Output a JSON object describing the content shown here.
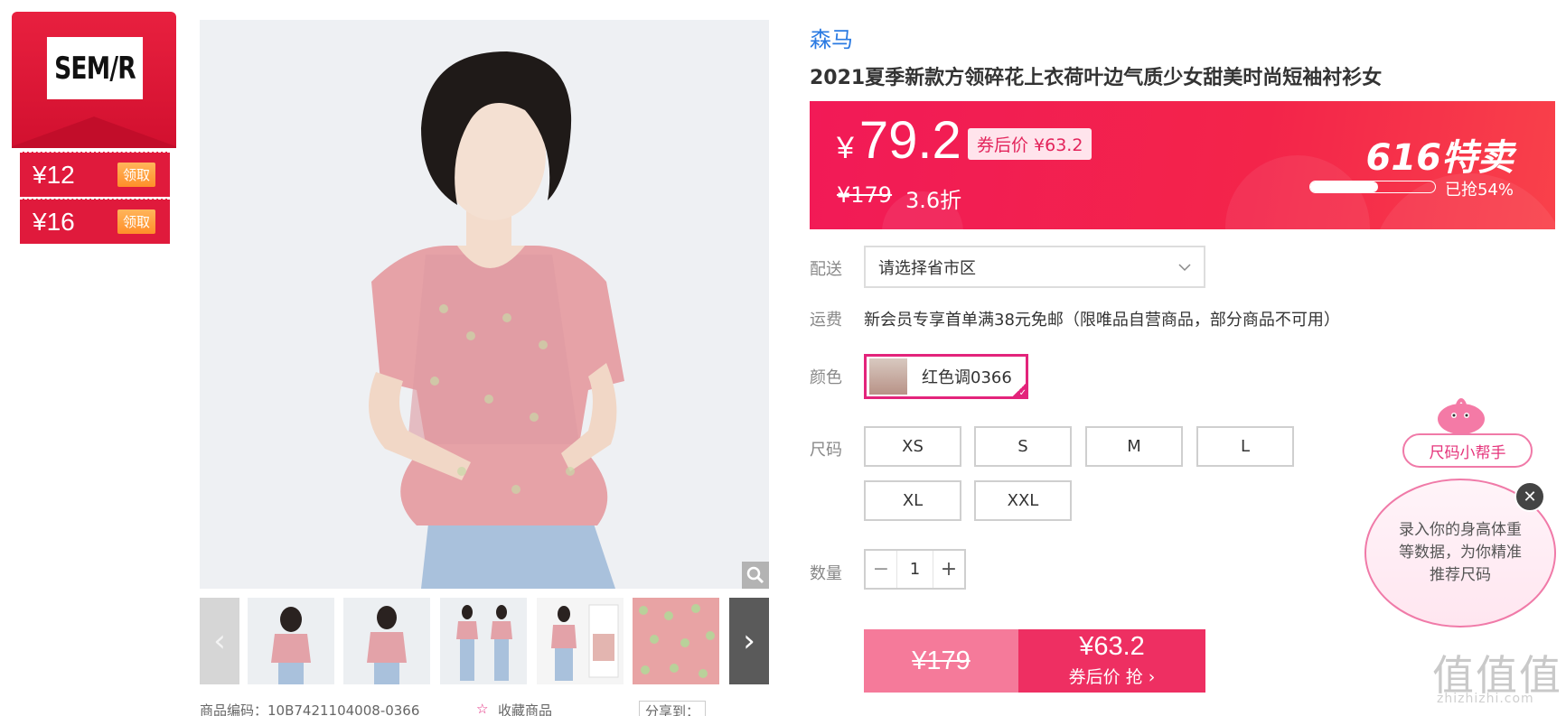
{
  "brand_badge": {
    "logo_text": "SEM/R",
    "coupons": [
      {
        "amount": "¥12",
        "action": "领取"
      },
      {
        "amount": "¥16",
        "action": "领取"
      }
    ]
  },
  "gallery": {
    "main_image": "floral-blouse-model-photo",
    "zoom_icon": "magnifier-icon",
    "thumbnail_count": 6,
    "prev_arrow": "‹",
    "next_arrow": "›",
    "bottom": {
      "product_code_label": "商品编码：10B7421104008-0366",
      "favorite_label": "收藏商品",
      "share_label": "分享到："
    }
  },
  "product": {
    "brand": "森马",
    "title": "2021夏季新款方领碎花上衣荷叶边气质少女甜美时尚短袖衬衫女"
  },
  "price_banner": {
    "currency": "¥",
    "price": "79.2",
    "after_coupon": "券后价 ¥63.2",
    "original_price": "¥179",
    "discount": "3.6折",
    "promo_logo": "616特卖",
    "sold_progress": 0.54,
    "sold_text": "已抢54%",
    "accent_color": "#f21a57"
  },
  "delivery": {
    "label": "配送",
    "placeholder": "请选择省市区"
  },
  "shipping_fee": {
    "label": "运费",
    "text": "新会员专享首单满38元免邮（限唯品自营商品，部分商品不可用）"
  },
  "color": {
    "label": "颜色",
    "selected": "红色调0366",
    "check_icon": "check-icon"
  },
  "size": {
    "label": "尺码",
    "options": [
      "XS",
      "S",
      "M",
      "L",
      "XL",
      "XXL"
    ]
  },
  "quantity": {
    "label": "数量",
    "minus": "−",
    "value": "1",
    "plus": "+"
  },
  "buy": {
    "original_price": "¥179",
    "price": "¥63.2",
    "sub_label": "券后价 抢 ›"
  },
  "size_helper": {
    "title": "尺码小帮手",
    "message": "录入你的身高体重等数据，为你精准推荐尺码",
    "close": "✕"
  },
  "watermark": {
    "text": "值值值",
    "url": "zhizhizhi.com"
  }
}
